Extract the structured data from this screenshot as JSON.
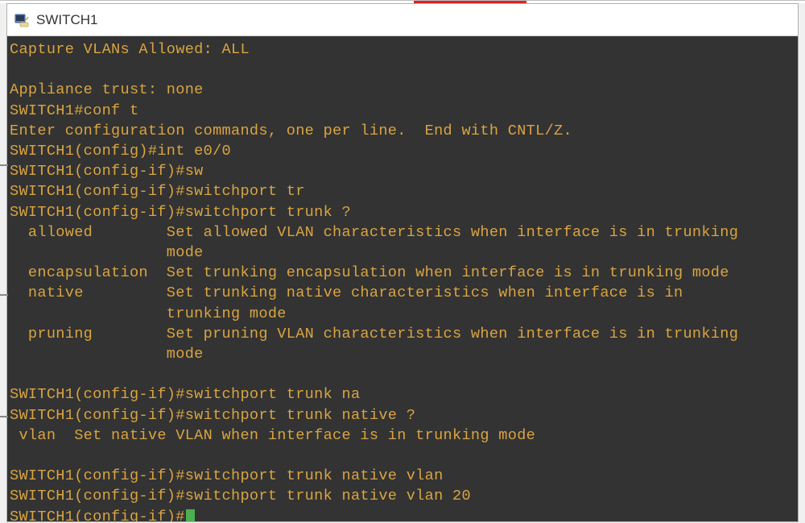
{
  "window": {
    "title": "SWITCH1"
  },
  "terminal": {
    "lines": [
      "Capture VLANs Allowed: ALL",
      "",
      "Appliance trust: none",
      "SWITCH1#conf t",
      "Enter configuration commands, one per line.  End with CNTL/Z.",
      "SWITCH1(config)#int e0/0",
      "SWITCH1(config-if)#sw",
      "SWITCH1(config-if)#switchport tr",
      "SWITCH1(config-if)#switchport trunk ?",
      "  allowed        Set allowed VLAN characteristics when interface is in trunking",
      "                 mode",
      "  encapsulation  Set trunking encapsulation when interface is in trunking mode",
      "  native         Set trunking native characteristics when interface is in",
      "                 trunking mode",
      "  pruning        Set pruning VLAN characteristics when interface is in trunking",
      "                 mode",
      "",
      "SWITCH1(config-if)#switchport trunk na",
      "SWITCH1(config-if)#switchport trunk native ?",
      " vlan  Set native VLAN when interface is in trunking mode",
      "",
      "SWITCH1(config-if)#switchport trunk native vlan",
      "SWITCH1(config-if)#switchport trunk native vlan 20"
    ],
    "prompt_last": "SWITCH1(config-if)#"
  },
  "colors": {
    "terminal_bg": "#333333",
    "terminal_fg": "#d9a441",
    "cursor": "#4caf50",
    "titlebar_bg": "#ffffff",
    "accent_red": "#d62828"
  }
}
